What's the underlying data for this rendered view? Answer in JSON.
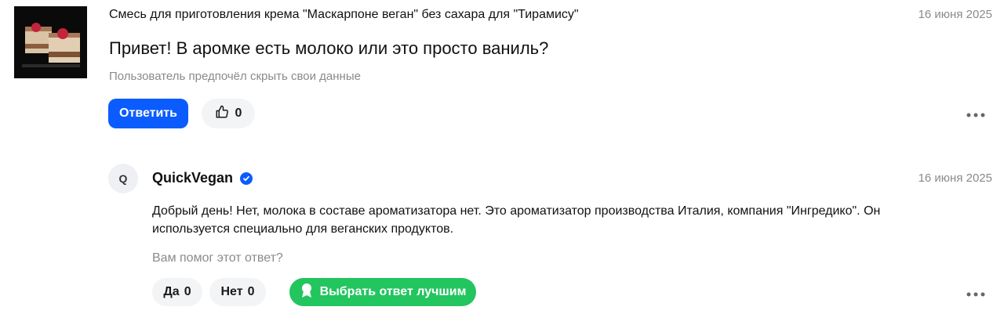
{
  "question": {
    "product_title": "Смесь для приготовления крема \"Маскарпоне веган\" без сахара для \"Тирамису\"",
    "date": "16 июня 2025",
    "text": "Привет! В аромке есть молоко или это просто ваниль?",
    "author_note": "Пользователь предпочёл скрыть свои данные",
    "reply_label": "Ответить",
    "like_count": "0",
    "icons": {
      "like": "thumbs-up-icon",
      "more": "more-dots-icon"
    }
  },
  "answer": {
    "avatar_letter": "Q",
    "author": "QuickVegan",
    "date": "16 июня 2025",
    "text": "Добрый день! Нет, молока в составе ароматизатора нет. Это ароматизатор производства Италия, компания \"Ингредико\". Он используется специально для веганских продуктов.",
    "helpful_question": "Вам помог этот ответ?",
    "yes_label": "Да",
    "yes_count": "0",
    "no_label": "Нет",
    "no_count": "0",
    "best_label": "Выбрать ответ лучшим",
    "icons": {
      "verified": "verified-badge-icon",
      "best": "award-icon",
      "more": "more-dots-icon"
    }
  },
  "colors": {
    "primary": "#0b5cff",
    "success": "#22c55e",
    "muted": "#8a8a8a"
  }
}
